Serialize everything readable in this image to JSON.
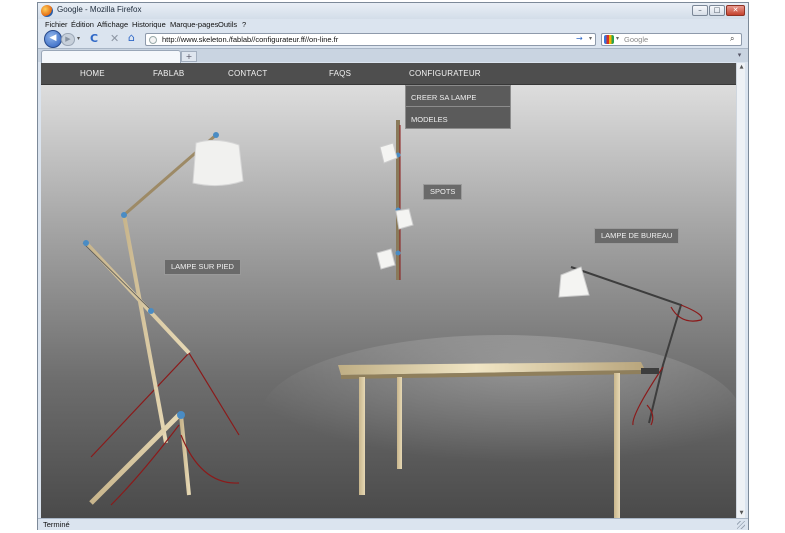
{
  "window": {
    "title": "Google - Mozilla Firefox",
    "min_glyph": "–",
    "max_glyph": "□",
    "close_glyph": "✕"
  },
  "menu": [
    {
      "label": "Fichier"
    },
    {
      "label": "Édition"
    },
    {
      "label": "Affichage"
    },
    {
      "label": "Historique"
    },
    {
      "label": "Marque-pages"
    },
    {
      "label": "Outils"
    },
    {
      "label": "?"
    }
  ],
  "toolbar": {
    "back_glyph": "◀",
    "forward_glyph": "▶",
    "reload_glyph": "C",
    "stop_glyph": "✕",
    "home_glyph": "⌂",
    "url": "http://www.skeleton./fablab//configurateur.ff//on-line.fr",
    "go_glyph": "→",
    "search_placeholder": "Google",
    "search_glyph": "⌕",
    "dropdown_glyph": "▾"
  },
  "tabs": {
    "new_tab_glyph": "+",
    "list_glyph": "▾"
  },
  "site": {
    "nav": [
      {
        "label": "HOME"
      },
      {
        "label": "FABLAB"
      },
      {
        "label": "CONTACT"
      },
      {
        "label": "FAQS"
      },
      {
        "label": "CONFIGURATEUR"
      }
    ],
    "dropdown": [
      {
        "label": "CREER SA LAMPE"
      },
      {
        "label": "MODELES"
      }
    ],
    "labels": {
      "spots": "SPOTS",
      "floor_lamp": "LAMPE SUR PIED",
      "desk_lamp": "LAMPE DE BUREAU"
    }
  },
  "status": {
    "text": "Terminé"
  },
  "colors": {
    "nav_bg": "#4e4e4e",
    "wood": "#d9c9a3",
    "cable_red": "#8b1a1a",
    "joint_blue": "#4a8cc4"
  }
}
